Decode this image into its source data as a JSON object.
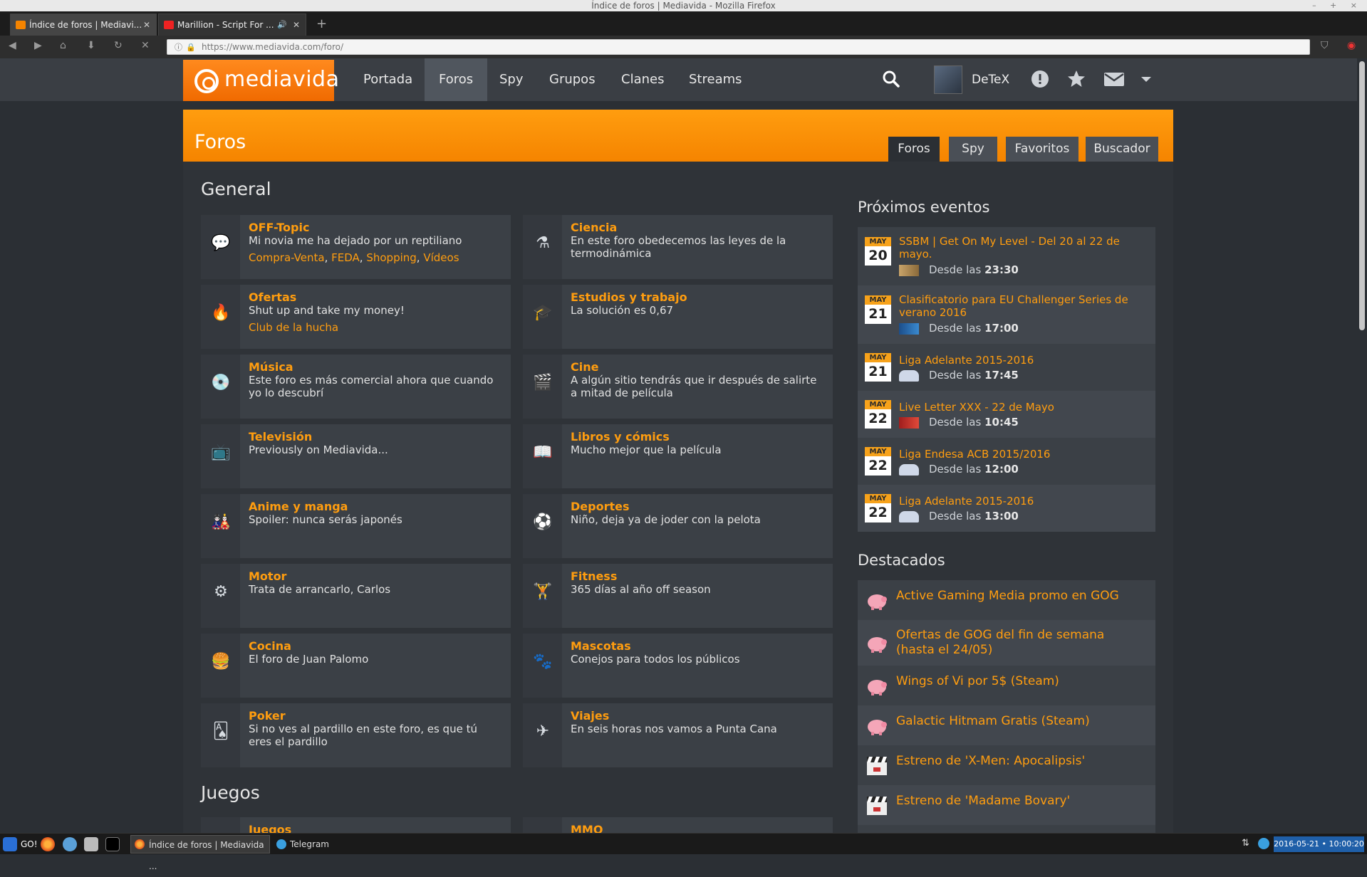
{
  "window": {
    "title": "Índice de foros | Mediavida - Mozilla Firefox"
  },
  "browser": {
    "tabs": [
      {
        "label": "Índice de foros | Mediavi...",
        "favicon_color": "#f58400"
      },
      {
        "label": "Marillion - Script For ...",
        "favicon_color": "#e22"
      }
    ],
    "new_tab": "+",
    "url": "https://www.mediavida.com/foro/"
  },
  "site": {
    "logo": "mediavida",
    "nav": [
      "Portada",
      "Foros",
      "Spy",
      "Grupos",
      "Clanes",
      "Streams"
    ],
    "username": "DeTeX"
  },
  "banner": {
    "title": "Foros",
    "tabs": [
      "Foros",
      "Spy",
      "Favoritos",
      "Buscador"
    ]
  },
  "sections": {
    "general": "General",
    "juegos": "Juegos"
  },
  "forums": [
    {
      "title": "OFF-Topic",
      "desc": "Mi novia me ha dejado por un reptiliano",
      "sub": [
        "Compra-Venta",
        "FEDA",
        "Shopping",
        "Vídeos"
      ],
      "icon": "speech-bubble-icon"
    },
    {
      "title": "Ciencia",
      "desc": "En este foro obedecemos las leyes de la termodinámica",
      "icon": "flask-icon"
    },
    {
      "title": "Ofertas",
      "desc": "Shut up and take my money!",
      "sub": [
        "Club de la hucha"
      ],
      "icon": "fire-icon"
    },
    {
      "title": "Estudios y trabajo",
      "desc": "La solución es 0,67",
      "icon": "graduation-cap-icon"
    },
    {
      "title": "Música",
      "desc": "Este foro es más comercial ahora que cuando yo lo descubrí",
      "icon": "vinyl-icon"
    },
    {
      "title": "Cine",
      "desc": "A algún sitio tendrás que ir después de salirte a mitad de película",
      "icon": "clapperboard-icon"
    },
    {
      "title": "Televisión",
      "desc": "Previously on Mediavida...",
      "icon": "tv-icon"
    },
    {
      "title": "Libros y cómics",
      "desc": "Mucho mejor que la película",
      "icon": "book-icon"
    },
    {
      "title": "Anime y manga",
      "desc": "Spoiler: nunca serás japonés",
      "icon": "anime-face-icon"
    },
    {
      "title": "Deportes",
      "desc": "Niño, deja ya de joder con la pelota",
      "icon": "soccer-ball-icon"
    },
    {
      "title": "Motor",
      "desc": "Trata de arrancarlo, Carlos",
      "icon": "tire-icon"
    },
    {
      "title": "Fitness",
      "desc": "365 días al año off season",
      "icon": "dumbbell-icon"
    },
    {
      "title": "Cocina",
      "desc": "El foro de Juan Palomo",
      "icon": "burger-icon"
    },
    {
      "title": "Mascotas",
      "desc": "Conejos para todos los públicos",
      "icon": "paw-icon"
    },
    {
      "title": "Poker",
      "desc": "Si no ves al pardillo en este foro, es que tú eres el pardillo",
      "icon": "playing-cards-icon"
    },
    {
      "title": "Viajes",
      "desc": "En seis horas nos vamos a Punta Cana",
      "icon": "airplane-icon"
    },
    {
      "title": "Juegos",
      "desc": "",
      "icon": "gamepad-icon"
    },
    {
      "title": "MMO",
      "desc": "",
      "icon": "sword-icon"
    }
  ],
  "events": {
    "title": "Próximos eventos",
    "since_label": "Desde las",
    "items": [
      {
        "month": "MAY",
        "day": "20",
        "title": "SSBM | Get On My Level - Del 20 al 22 de mayo.",
        "time": "23:30",
        "icon": "game-controller-icon"
      },
      {
        "month": "MAY",
        "day": "21",
        "title": "Clasificatorio para EU Challenger Series de verano 2016",
        "time": "17:00",
        "icon": "lol-icon"
      },
      {
        "month": "MAY",
        "day": "21",
        "title": "Liga Adelante 2015-2016",
        "time": "17:45",
        "icon": "football-icon"
      },
      {
        "month": "MAY",
        "day": "22",
        "title": "Live Letter XXX - 22 de Mayo",
        "time": "10:45",
        "icon": "ffxiv-icon"
      },
      {
        "month": "MAY",
        "day": "22",
        "title": "Liga Endesa ACB 2015/2016",
        "time": "12:00",
        "icon": "basketball-icon"
      },
      {
        "month": "MAY",
        "day": "22",
        "title": "Liga Adelante 2015-2016",
        "time": "13:00",
        "icon": "football-icon"
      }
    ]
  },
  "featured": {
    "title": "Destacados",
    "items": [
      {
        "text": "Active Gaming Media promo en GOG",
        "icon": "piggy-bank-icon"
      },
      {
        "text": "Ofertas de GOG del fin de semana (hasta el 24/05)",
        "icon": "piggy-bank-icon"
      },
      {
        "text": "Wings of Vi por 5$ (Steam)",
        "icon": "piggy-bank-icon"
      },
      {
        "text": "Galactic Hitmam Gratis (Steam)",
        "icon": "piggy-bank-icon"
      },
      {
        "text": "Estreno de 'X-Men: Apocalipsis'",
        "icon": "clapperboard-icon"
      },
      {
        "text": "Estreno de 'Madame Bovary'",
        "icon": "clapperboard-icon"
      }
    ]
  },
  "taskbar": {
    "start": "GO!",
    "tasks": [
      "Índice de foros | Mediavida ...",
      "Telegram"
    ],
    "clock": "2016-05-21 • 10:00:20"
  },
  "colors": {
    "accent": "#ff9d0f",
    "brand": "#f58400",
    "page_bg": "#2f3338",
    "card_bg": "#3b4046"
  }
}
